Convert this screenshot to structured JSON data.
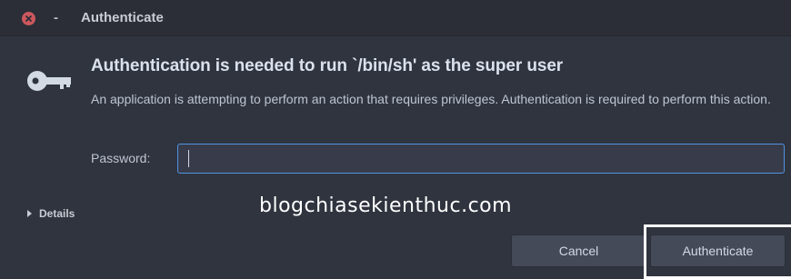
{
  "window": {
    "title": "Authenticate",
    "minimize_glyph": "-"
  },
  "dialog": {
    "heading": "Authentication is needed to run `/bin/sh' as the super user",
    "description": "An application is attempting to perform an action that requires privileges. Authentication is required to perform this action.",
    "password_label": "Password:",
    "password_value": "",
    "details_label": "Details"
  },
  "watermark": "blogchiasekienthuc.com",
  "buttons": {
    "cancel": "Cancel",
    "authenticate": "Authenticate"
  },
  "icons": {
    "close": "close-icon",
    "key": "key-icon",
    "details_arrow": "chevron-right-icon"
  },
  "colors": {
    "window_bg": "#2f343f",
    "titlebar_bg": "#2b2e37",
    "close_red": "#cc575d",
    "focus_blue": "#5294e2",
    "button_bg": "#444a58",
    "highlight_border": "#ffffff"
  }
}
